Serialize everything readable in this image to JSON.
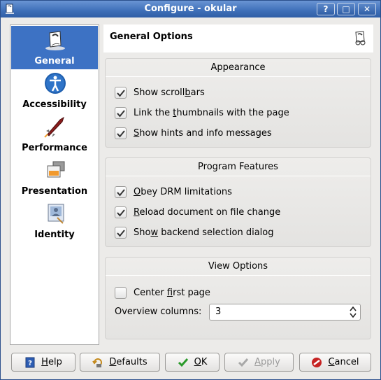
{
  "window": {
    "title": "Configure - okular"
  },
  "titlebar_buttons": {
    "help": "?",
    "maximize": "□",
    "close": "✕"
  },
  "sidebar": {
    "items": [
      {
        "label": "General",
        "icon": "okular-icon",
        "active": true
      },
      {
        "label": "Accessibility",
        "icon": "accessibility-icon",
        "active": false
      },
      {
        "label": "Performance",
        "icon": "rocket-icon",
        "active": false
      },
      {
        "label": "Presentation",
        "icon": "presentation-icon",
        "active": false
      },
      {
        "label": "Identity",
        "icon": "identity-icon",
        "active": false
      }
    ]
  },
  "header": {
    "title": "General Options"
  },
  "appearance": {
    "title": "Appearance",
    "options": [
      {
        "pre": "Show scroll",
        "acc": "b",
        "post": "ars",
        "checked": true
      },
      {
        "pre": "Link the ",
        "acc": "t",
        "post": "humbnails with the page",
        "checked": true
      },
      {
        "pre": "",
        "acc": "S",
        "post": "how hints and info messages",
        "checked": true
      }
    ]
  },
  "program": {
    "title": "Program Features",
    "options": [
      {
        "pre": "",
        "acc": "O",
        "post": "bey DRM limitations",
        "checked": true
      },
      {
        "pre": "",
        "acc": "R",
        "post": "eload document on file change",
        "checked": true
      },
      {
        "pre": "Sho",
        "acc": "w",
        "post": " backend selection dialog",
        "checked": true
      }
    ]
  },
  "view": {
    "title": "View Options",
    "center": {
      "pre": "Center ",
      "acc": "f",
      "post": "irst page",
      "checked": false
    },
    "overview_label": "Overview columns:",
    "overview_value": "3"
  },
  "buttons": {
    "help": {
      "acc": "H",
      "post": "elp"
    },
    "defaults": {
      "acc": "D",
      "post": "efaults"
    },
    "ok": {
      "pre": "",
      "acc": "O",
      "post": "K"
    },
    "apply": {
      "acc": "A",
      "post": "pply"
    },
    "cancel": {
      "acc": "C",
      "post": "ancel"
    }
  },
  "colors": {
    "accent": "#3d72c4",
    "titlebar": "#3e6fb8"
  }
}
